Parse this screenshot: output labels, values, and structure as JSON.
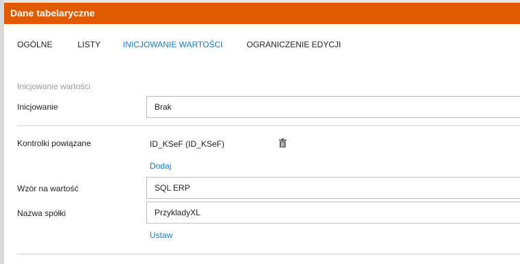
{
  "header": {
    "title": "Dane tabelaryczne"
  },
  "tabs": [
    {
      "label": "OGÓLNE",
      "active": false
    },
    {
      "label": "LISTY",
      "active": false
    },
    {
      "label": "INICJOWANIE WARTOŚCI",
      "active": true
    },
    {
      "label": "OGRANICZENIE EDYCJI",
      "active": false
    }
  ],
  "section": {
    "title": "Inicjowanie wartości"
  },
  "initialization": {
    "label": "Inicjowanie",
    "value": "Brak"
  },
  "linked_controls": {
    "label": "Kontrolki powiązane",
    "items": [
      {
        "text": "ID_KSeF (ID_KSeF)",
        "icon": "trash-icon"
      }
    ],
    "add_link": "Dodaj"
  },
  "value_pattern": {
    "label": "Wzór na wartość",
    "value": "SQL ERP"
  },
  "company_name": {
    "label": "Nazwa spółki",
    "value": "PrzykladyXL"
  },
  "set_link": "Ustaw",
  "colors": {
    "header_bg": "#e05a00",
    "accent": "#1a78c2"
  }
}
